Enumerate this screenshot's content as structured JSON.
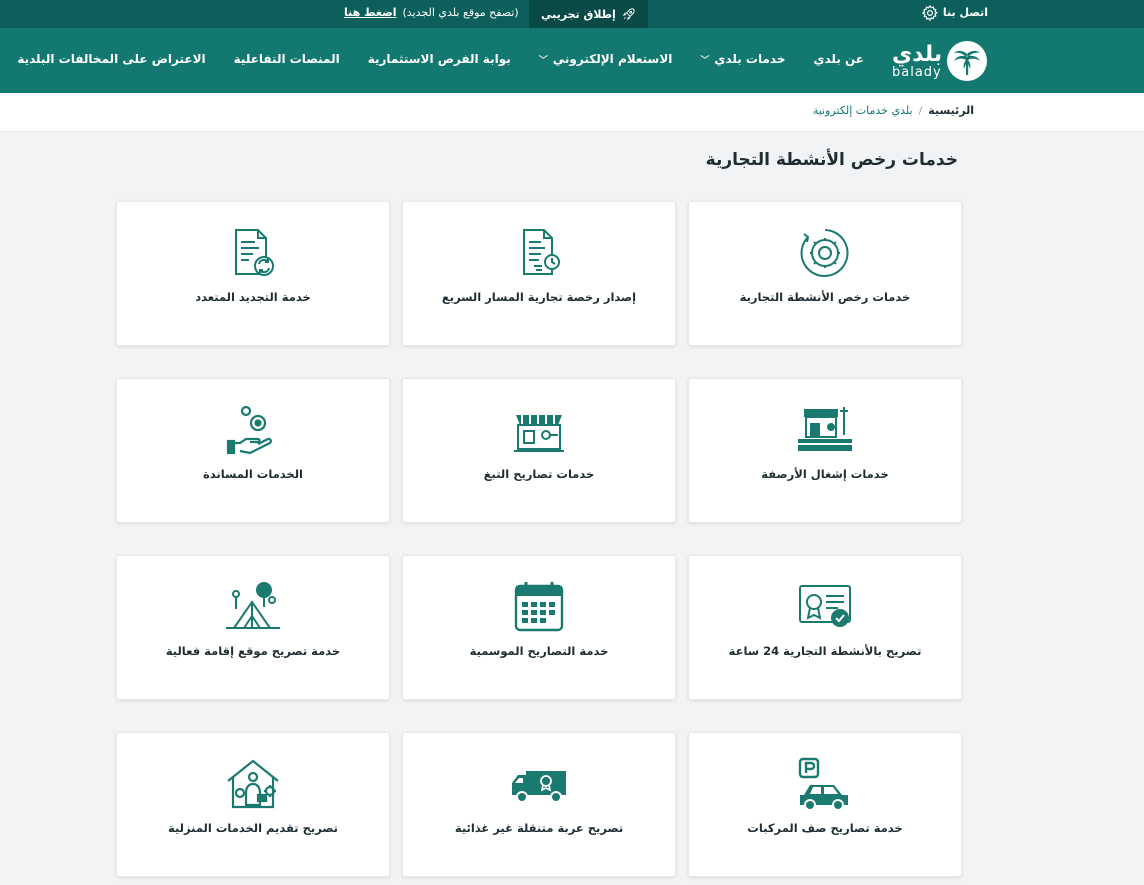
{
  "topbar": {
    "contact_label": "اتصل بنا",
    "settings_icon": "gear-icon",
    "beta_label": "إطلاق تجريبي",
    "beta_icon": "rocket-icon",
    "beta_note": "(تصفح موقع بلدي الجديد)",
    "beta_link": "اضغط هنا"
  },
  "header": {
    "logo_ar": "بلدي",
    "logo_en": "balady",
    "nav": [
      {
        "label": "عن بلدي",
        "has_dropdown": false
      },
      {
        "label": "خدمات بلدي",
        "has_dropdown": true
      },
      {
        "label": "الاستعلام الإلكتروني",
        "has_dropdown": true
      },
      {
        "label": "بوابة الفرص الاستثمارية",
        "has_dropdown": false
      },
      {
        "label": "المنصات التفاعلية",
        "has_dropdown": false
      },
      {
        "label": "الاعتراض على المخالفات البلدية",
        "has_dropdown": false
      }
    ]
  },
  "breadcrumb": {
    "home": "الرئيسية",
    "separator": "/",
    "current": "بلدي خدمات إلكترونية"
  },
  "page": {
    "title": "خدمات رخص الأنشطة التجارية"
  },
  "cards": [
    {
      "label": "خدمات رخص الأنشطة التجارية",
      "icon": "gear-cycle-icon"
    },
    {
      "label": "إصدار رخصة تجارية المسار السريع",
      "icon": "fast-document-icon"
    },
    {
      "label": "خدمة التجديد المتعدد",
      "icon": "document-renew-icon"
    },
    {
      "label": "خدمات إشغال الأرصفة",
      "icon": "storefront-sidewalk-icon"
    },
    {
      "label": "خدمات تصاريح التبغ",
      "icon": "kiosk-tobacco-icon"
    },
    {
      "label": "الخدمات المساندة",
      "icon": "hand-gears-icon"
    },
    {
      "label": "تصريح بالأنشطة التجارية 24 ساعة",
      "icon": "certificate-check-icon"
    },
    {
      "label": "خدمة التصاريح الموسمية",
      "icon": "calendar-icon"
    },
    {
      "label": "خدمة تصريح موقع إقامة فعالية",
      "icon": "event-tent-icon"
    },
    {
      "label": "خدمة تصاريح صف المركبات",
      "icon": "parking-car-icon"
    },
    {
      "label": "تصريح عربة متنقلة غير غذائية",
      "icon": "delivery-truck-icon"
    },
    {
      "label": "تصريح تقديم الخدمات المنزلية",
      "icon": "home-services-icon"
    }
  ],
  "colors": {
    "topbar": "#0c5f5a",
    "header": "#13786f",
    "icon": "#1a7a70",
    "background": "#f1f3f5"
  }
}
